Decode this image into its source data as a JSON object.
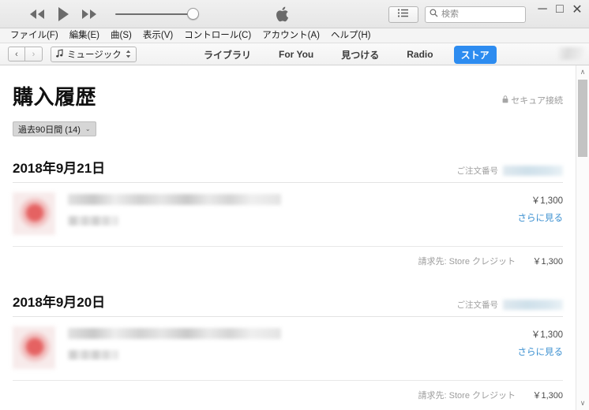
{
  "window": {
    "minimize_label": "─",
    "maximize_label": "□",
    "close_label": "✕",
    "apple_logo_name": "apple-logo"
  },
  "player": {
    "rewind_label": "◀◀",
    "play_label": "▶",
    "fastforward_label": "▶▶",
    "volume_level": 100
  },
  "search": {
    "placeholder": "検索",
    "value": "",
    "icon": "search-icon"
  },
  "listview_button": {
    "icon": "list-icon"
  },
  "menubar": {
    "items": [
      {
        "label": "ファイル(F)"
      },
      {
        "label": "編集(E)"
      },
      {
        "label": "曲(S)"
      },
      {
        "label": "表示(V)"
      },
      {
        "label": "コントロール(C)"
      },
      {
        "label": "アカウント(A)"
      },
      {
        "label": "ヘルプ(H)"
      }
    ]
  },
  "navbar": {
    "back_label": "‹",
    "forward_label": "›",
    "library_select": {
      "icon": "music-note-icon",
      "label": "ミュージック",
      "chevron": "⇅"
    },
    "tabs": [
      {
        "label": "ライブラリ",
        "active": false
      },
      {
        "label": "For You",
        "active": false
      },
      {
        "label": "見つける",
        "active": false
      },
      {
        "label": "Radio",
        "active": false
      },
      {
        "label": "ストア",
        "active": true
      }
    ]
  },
  "page": {
    "title": "購入履歴",
    "secure": {
      "icon": "lock-icon",
      "label": "セキュア接続"
    },
    "filter": {
      "label": "過去90日間 (14)",
      "chevron": "⌄"
    },
    "order_number_label": "ご注文番号",
    "see_more_label": "さらに見る",
    "billed_to_label": "請求先: Store クレジット",
    "orders": [
      {
        "date": "2018年9月21日",
        "item_price": "￥1,300",
        "total": "￥1,300"
      },
      {
        "date": "2018年9月20日",
        "item_price": "￥1,300",
        "total": "￥1,300"
      }
    ]
  },
  "scrollbar": {
    "up_label": "∧",
    "down_label": "∨"
  }
}
